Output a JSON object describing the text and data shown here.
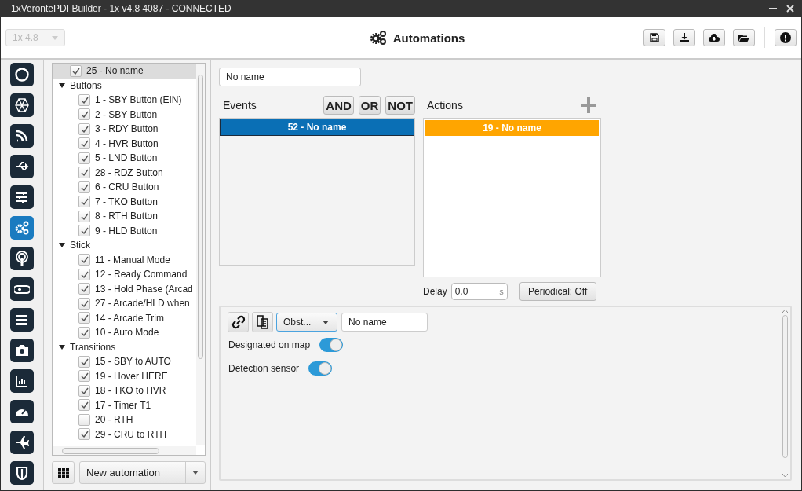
{
  "window": {
    "title": "1xVerontePDI Builder - 1x v4.8 4087 - CONNECTED"
  },
  "header": {
    "version_select": "1x 4.8",
    "title": "Automations"
  },
  "sidebar": {
    "items": [
      {
        "selected": false
      },
      {
        "selected": false
      },
      {
        "selected": false
      },
      {
        "selected": false
      },
      {
        "selected": false
      },
      {
        "selected": true
      },
      {
        "selected": false
      },
      {
        "selected": false
      },
      {
        "selected": false
      },
      {
        "selected": false
      },
      {
        "selected": false
      },
      {
        "selected": false
      },
      {
        "selected": false
      },
      {
        "selected": false
      }
    ]
  },
  "tree": {
    "items": [
      {
        "label": "25 - No name",
        "checked": true,
        "selected": true
      },
      {
        "label": "Buttons",
        "expanded": true,
        "children": [
          {
            "label": "1 - SBY Button (EIN)",
            "checked": true
          },
          {
            "label": "2 - SBY Button",
            "checked": true
          },
          {
            "label": "3 - RDY Button",
            "checked": true
          },
          {
            "label": "4 - HVR Button",
            "checked": true
          },
          {
            "label": "5 - LND Button",
            "checked": true
          },
          {
            "label": "28 - RDZ Button",
            "checked": true
          },
          {
            "label": "6 - CRU Button",
            "checked": true
          },
          {
            "label": "7 - TKO Button",
            "checked": true
          },
          {
            "label": "8 - RTH Button",
            "checked": true
          },
          {
            "label": "9 - HLD Button",
            "checked": true
          }
        ]
      },
      {
        "label": "Stick",
        "expanded": true,
        "children": [
          {
            "label": "11 - Manual Mode",
            "checked": true
          },
          {
            "label": "12 - Ready Command",
            "checked": true
          },
          {
            "label": "13 - Hold Phase (Arcad",
            "checked": true
          },
          {
            "label": "27 - Arcade/HLD when",
            "checked": true
          },
          {
            "label": "14 - Arcade Trim",
            "checked": true
          },
          {
            "label": "10 - Auto Mode",
            "checked": true
          }
        ]
      },
      {
        "label": "Transitions",
        "expanded": true,
        "children": [
          {
            "label": "15 - SBY to AUTO",
            "checked": true
          },
          {
            "label": "19 - Hover HERE",
            "checked": true
          },
          {
            "label": "18 - TKO to HVR",
            "checked": true
          },
          {
            "label": "17 - Timer T1",
            "checked": true
          },
          {
            "label": "20 - RTH",
            "checked": false
          },
          {
            "label": "29 - CRU to RTH",
            "checked": true
          }
        ]
      }
    ]
  },
  "new_automation": "New automation",
  "name_field": "No name",
  "events": {
    "label": "Events",
    "operators": [
      "AND",
      "OR",
      "NOT"
    ],
    "items": [
      "52 - No name"
    ]
  },
  "actions": {
    "label": "Actions",
    "items": [
      "19 - No name"
    ]
  },
  "delay": {
    "label": "Delay",
    "value": "0.0",
    "unit": "s"
  },
  "periodical": "Periodical: Off",
  "action_editor": {
    "type_select": "Obst...",
    "name": "No name",
    "options": [
      {
        "label": "Designated on map",
        "on": true
      },
      {
        "label": "Detection sensor",
        "on": true
      }
    ]
  }
}
